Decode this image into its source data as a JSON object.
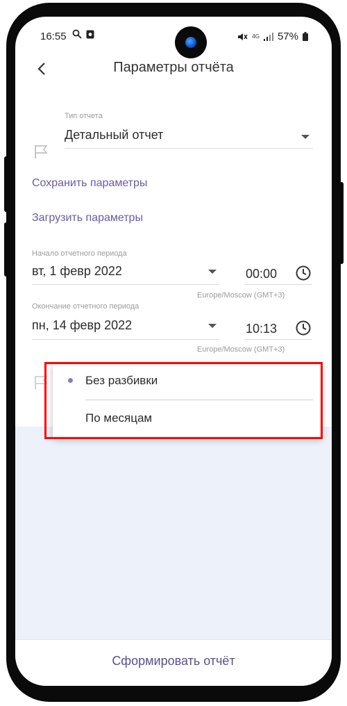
{
  "status": {
    "time": "16:55",
    "network": "4G",
    "battery": "57%"
  },
  "appbar": {
    "title": "Параметры отчёта",
    "back_icon": "chevron-left-icon"
  },
  "report_type": {
    "label": "Тип отчета",
    "value": "Детальный отчет"
  },
  "actions": {
    "save": "Сохранить параметры",
    "load": "Загрузить параметры"
  },
  "period_start": {
    "label": "Начало отчетного периода",
    "date": "вт, 1 февр 2022",
    "time": "00:00",
    "timezone": "Europe/Moscow (GMT+3)"
  },
  "period_end": {
    "label": "Окончание отчетного периода",
    "date": "пн, 14 февр 2022",
    "time": "10:13",
    "timezone": "Europe/Moscow (GMT+3)"
  },
  "grouping_menu": {
    "items": [
      {
        "label": "Без разбивки",
        "selected": true
      },
      {
        "label": "По месяцам",
        "selected": false
      }
    ]
  },
  "footer": {
    "generate": "Сформировать отчёт"
  },
  "colors": {
    "accent": "#6a5aa6",
    "highlight": "#ff0000",
    "background_lower": "#edf1fa"
  }
}
